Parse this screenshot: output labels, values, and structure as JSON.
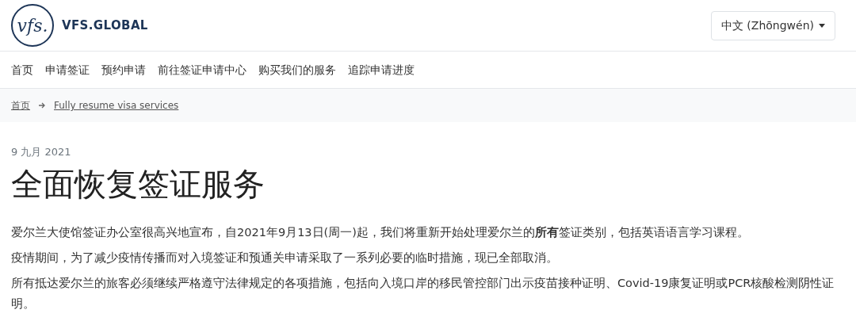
{
  "header": {
    "logo_mark": "vfs.",
    "logo_text": "VFS.GLOBAL",
    "language_button": "中文 (Zhōngwén)"
  },
  "nav": {
    "items": [
      "首页",
      "申请签证",
      "预约申请",
      "前往签证申请中心",
      "购买我们的服务",
      "追踪申请进度"
    ]
  },
  "breadcrumb": {
    "items": [
      "首页",
      "Fully resume visa services"
    ]
  },
  "article": {
    "date": "9 九月 2021",
    "title": "全面恢复签证服务",
    "paragraphs": [
      "爱尔兰大使馆签证办公室很高兴地宣布，自2021年9月13日(周一)起，我们将重新开始处理爱尔兰的**所有**签证类别，包括英语语言学习课程。",
      "疫情期间，为了减少疫情传播而对入境签证和预通关申请采取了一系列必要的临时措施，现已全部取消。",
      "所有抵达爱尔兰的旅客必须继续严格遵守法律规定的各项措施，包括向入境口岸的移民管控部门出示疫苗接种证明、Covid-19康复证明或PCR核酸检测阴性证明。"
    ]
  }
}
